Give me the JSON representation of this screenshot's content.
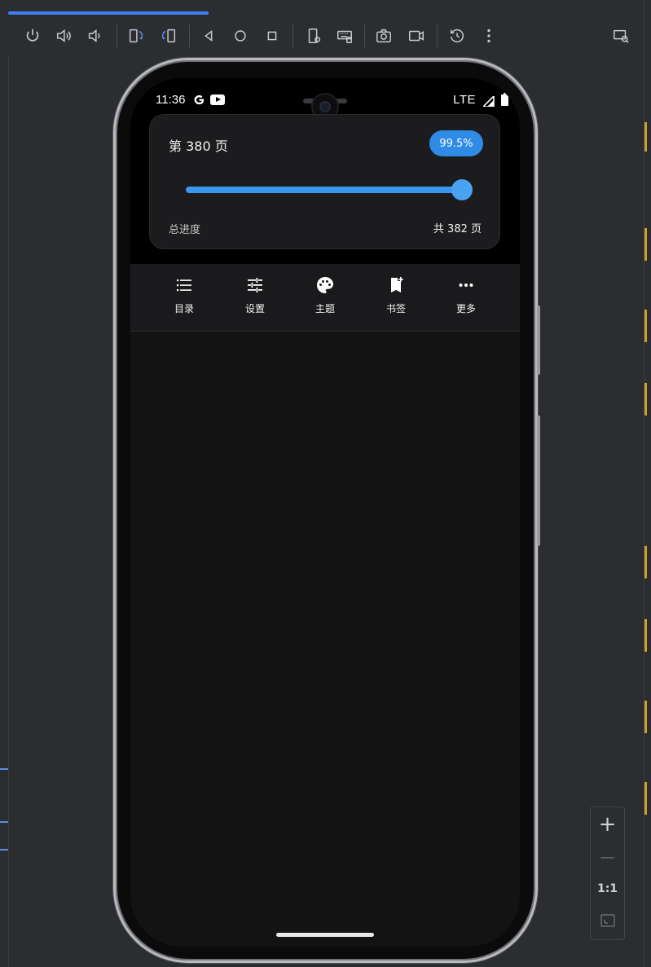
{
  "toolbar": {
    "icons": [
      "power-icon",
      "volume-up-icon",
      "volume-down-icon",
      "rotate-left-icon",
      "rotate-right-icon",
      "back-icon",
      "home-icon",
      "overview-icon",
      "device-settings-icon",
      "keyboard-icon",
      "screenshot-icon",
      "screen-record-icon",
      "reset-icon",
      "more-vert-icon",
      "device-mirror-icon"
    ]
  },
  "status": {
    "time": "11:36",
    "network": "LTE"
  },
  "progress": {
    "page_label": "第 380 页",
    "percent_label": "99.5%",
    "percent_value": 0.995,
    "total_label": "总进度",
    "total_pages": "共 382 页"
  },
  "menu": {
    "items": [
      {
        "label": "目录",
        "icon": "list-icon"
      },
      {
        "label": "设置",
        "icon": "tune-icon"
      },
      {
        "label": "主题",
        "icon": "palette-icon"
      },
      {
        "label": "书签",
        "icon": "bookmark-add-icon"
      },
      {
        "label": "更多",
        "icon": "more-horiz-icon"
      }
    ]
  },
  "zoom": {
    "plus": "+",
    "minus": "—",
    "one_to_one": "1:1"
  },
  "colors": {
    "accent": "#2f8be6",
    "slider": "#3b97ee",
    "screen_bg": "#131314",
    "card_bg": "#1c1c1e"
  }
}
